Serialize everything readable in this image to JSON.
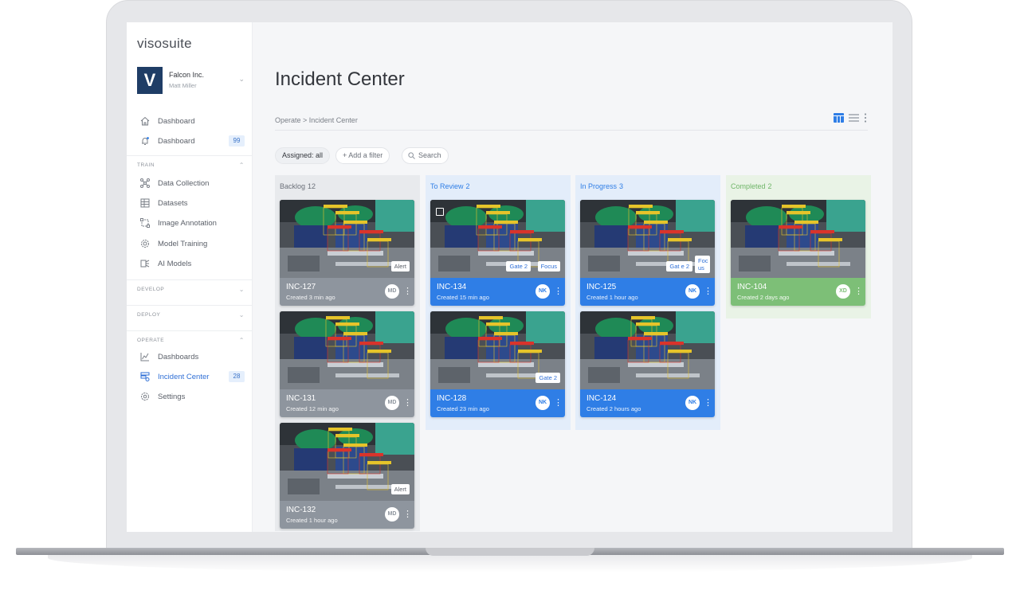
{
  "sidebar": {
    "brand": "visosuite",
    "org": {
      "logo_letter": "V",
      "name": "Falcon Inc.",
      "user": "Matt Miller"
    },
    "top_items": [
      {
        "label": "Dashboard",
        "icon": "home-icon"
      },
      {
        "label": "Notifications",
        "icon": "bell-icon",
        "badge": "99"
      }
    ],
    "sections": {
      "train": {
        "label": "TRAIN",
        "items": [
          "Data Collection",
          "Datasets",
          "Image Annotation",
          "Model Training",
          "AI Models"
        ]
      },
      "develop": {
        "label": "DEVELOP"
      },
      "deploy": {
        "label": "DEPLOY"
      },
      "operate": {
        "label": "OPERATE",
        "items": [
          "Dashboards",
          "Incident Center",
          "Settings"
        ],
        "incident_badge": "28"
      }
    }
  },
  "main": {
    "title": "Incident Center",
    "breadcrumb": "Operate  >  Incident Center",
    "filters": {
      "assigned": "Assigned: all",
      "add_filter": "+  Add a filter",
      "search": "Search"
    },
    "columns": [
      {
        "title": "Backlog",
        "count": "12",
        "color": "#6b7079",
        "bg": "#e8eaed",
        "cards": [
          {
            "id": "INC-127",
            "sub": "Created 3 min ago",
            "avatar": "MD",
            "tags": [
              "Alert"
            ]
          },
          {
            "id": "INC-131",
            "sub": "Created 12 min ago",
            "avatar": "MD",
            "tags": []
          },
          {
            "id": "INC-132",
            "sub": "Created 1 hour ago",
            "avatar": "MD",
            "tags": [
              "Alert"
            ]
          }
        ]
      },
      {
        "title": "To Review",
        "count": "2",
        "color": "#2f7ee6",
        "bg": "#e3edfa",
        "cards": [
          {
            "id": "INC-134",
            "sub": "Created 15 min ago",
            "avatar": "NK",
            "tags": [
              "Gate 2",
              "Focus"
            ]
          },
          {
            "id": "INC-128",
            "sub": "Created 23 min ago",
            "avatar": "NK",
            "tags": [
              "Gate 2"
            ]
          }
        ]
      },
      {
        "title": "In Progress",
        "count": "3",
        "color": "#2f7ee6",
        "bg": "#e3edfa",
        "cards": [
          {
            "id": "INC-125",
            "sub": "Created 1 hour ago",
            "avatar": "NK",
            "tags": [
              "Gat e 2",
              "Foc us"
            ]
          },
          {
            "id": "INC-124",
            "sub": "Created 2 hours ago",
            "avatar": "NK",
            "tags": []
          }
        ]
      },
      {
        "title": "Completed",
        "count": "2",
        "color": "#6fb568",
        "bg": "#e9f3e6",
        "cards": [
          {
            "id": "INC-104",
            "sub": "Created 2 days ago",
            "avatar": "XD",
            "tags": []
          }
        ]
      }
    ]
  },
  "colors": {
    "accent": "#2f7ee6",
    "backlog_card": "#8e959e",
    "completed_card": "#7dbf77"
  }
}
